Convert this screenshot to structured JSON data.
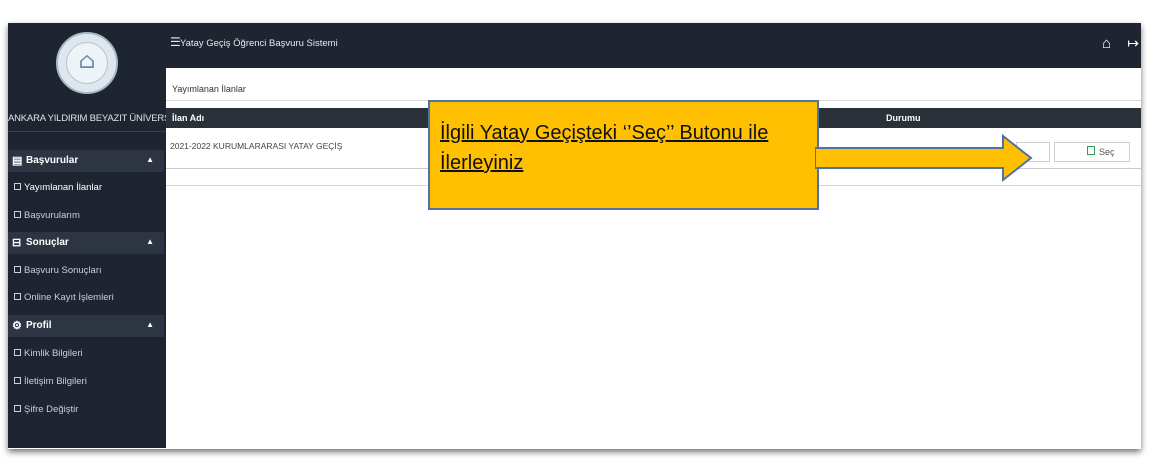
{
  "app": {
    "title": "Yatay Geçiş Öğrenci Başvuru Sistemi"
  },
  "university": {
    "name": "ANKARA YILDIRIM BEYAZIT ÜNİVERSİT"
  },
  "sidebar": {
    "groups": [
      {
        "label": "Başvurular",
        "icon": "document-icon",
        "items": [
          {
            "label": "Yayımlanan İlanlar"
          },
          {
            "label": "Başvurularım"
          }
        ]
      },
      {
        "label": "Sonuçlar",
        "icon": "inbox-icon",
        "items": [
          {
            "label": "Başvuru Sonuçları"
          },
          {
            "label": "Online Kayıt İşlemleri"
          }
        ]
      },
      {
        "label": "Profil",
        "icon": "gears-icon",
        "items": [
          {
            "label": "Kimlik Bilgileri"
          },
          {
            "label": "İletişim Bilgileri"
          },
          {
            "label": "Şifre Değiştir"
          }
        ]
      }
    ]
  },
  "topbar": {
    "home_icon": "home-icon",
    "logout_icon": "logout-icon"
  },
  "breadcrumb": "Yayımlanan İlanlar",
  "table": {
    "columns": [
      "İlan Adı",
      "Durumu"
    ],
    "rows": [
      {
        "ilan_adi": "2021-2022 KURUMLARARASI YATAY GEÇİŞ",
        "button": "Seç"
      }
    ]
  },
  "callout": {
    "line1": "İlgili Yatay Geçişteki ‘’Seç’’ Butonu ile",
    "line2": "İlerleyiniz"
  },
  "colors": {
    "dark_nav": "#1f2530",
    "callout_bg": "#fec000",
    "callout_border": "#4f71a3"
  }
}
